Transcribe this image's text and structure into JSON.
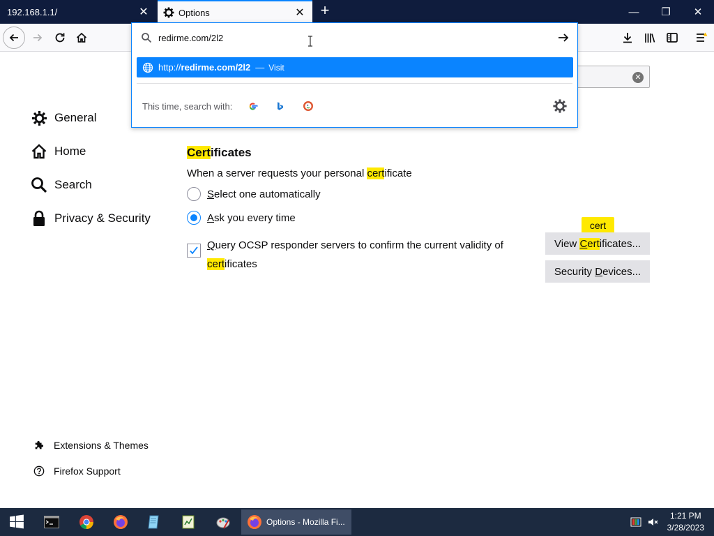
{
  "tabs": [
    {
      "title": "192.168.1.1/",
      "close": "✕"
    },
    {
      "title": "Options",
      "close": "✕"
    }
  ],
  "window_controls": {
    "minimize": "—",
    "restore": "❐",
    "close": "✕"
  },
  "urlbar": {
    "value": "redirme.com/2l2",
    "result_prefix": "http://",
    "result_host": "redirme.com/2l2",
    "result_sep": "—",
    "result_action": "Visit",
    "oneoff_label": "This time, search with:"
  },
  "sidebar": {
    "items": [
      {
        "label": "General",
        "icon": "gear-icon"
      },
      {
        "label": "Home",
        "icon": "home-icon"
      },
      {
        "label": "Search",
        "icon": "search-icon"
      },
      {
        "label": "Privacy & Security",
        "icon": "lock-icon"
      }
    ],
    "footer": [
      {
        "label": "Extensions & Themes",
        "icon": "puzzle-icon"
      },
      {
        "label": "Firefox Support",
        "icon": "help-icon"
      }
    ]
  },
  "certificates": {
    "title_hl": "Cert",
    "title_rest": "ificates",
    "desc_pre": "When a server requests your personal ",
    "desc_hl": "cert",
    "desc_post": "ificate",
    "option_auto": "Select one automatically",
    "option_auto_key": "S",
    "option_ask": "Ask you every time",
    "option_ask_key": "A",
    "ocsp_line1_key": "Q",
    "ocsp_line1": "uery OCSP responder servers to confirm the current validity of",
    "ocsp_line2_hl": "cert",
    "ocsp_line2_rest": "ificates",
    "view_pre": "View ",
    "view_key": "C",
    "view_hl": "ert",
    "view_post": "ificates...",
    "devices_pre": "Security ",
    "devices_key": "D",
    "devices_post": "evices...",
    "tooltip": "cert"
  },
  "taskbar": {
    "active_title": "Options - Mozilla Fi...",
    "time": "1:21 PM",
    "date": "3/28/2023"
  },
  "colors": {
    "accent": "#0a84ff",
    "highlight": "#ffe900",
    "tabbar": "#0f1c3d",
    "taskbar": "#1c2a40"
  }
}
